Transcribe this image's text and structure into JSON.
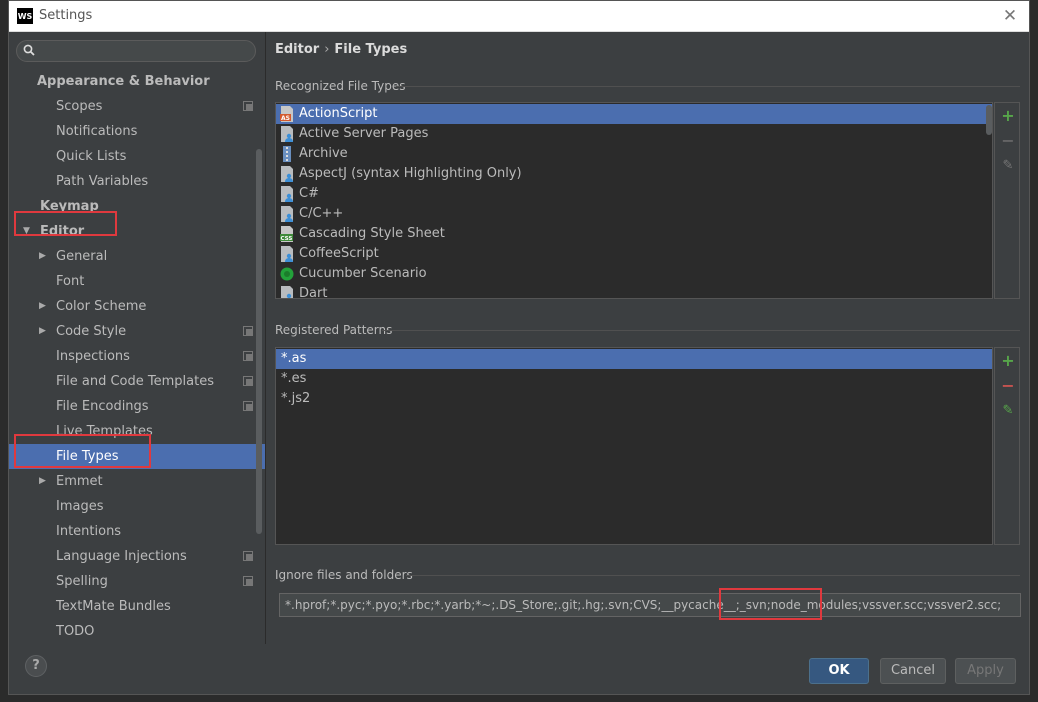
{
  "window": {
    "title": "Settings",
    "logo": "WS"
  },
  "search": {
    "placeholder": "",
    "value": ""
  },
  "nav": [
    {
      "label": "Appearance & Behavior",
      "type": "group"
    },
    {
      "label": "Scopes",
      "indent": 2,
      "proj": true
    },
    {
      "label": "Notifications",
      "indent": 2
    },
    {
      "label": "Quick Lists",
      "indent": 2
    },
    {
      "label": "Path Variables",
      "indent": 2
    },
    {
      "label": "Keymap",
      "type": "group"
    },
    {
      "label": "Editor",
      "type": "group-open"
    },
    {
      "label": "General",
      "indent": 2,
      "expandable": true
    },
    {
      "label": "Font",
      "indent": 2
    },
    {
      "label": "Color Scheme",
      "indent": 2,
      "expandable": true
    },
    {
      "label": "Code Style",
      "indent": 2,
      "expandable": true,
      "proj": true
    },
    {
      "label": "Inspections",
      "indent": 2,
      "proj": true
    },
    {
      "label": "File and Code Templates",
      "indent": 2,
      "proj": true
    },
    {
      "label": "File Encodings",
      "indent": 2,
      "proj": true
    },
    {
      "label": "Live Templates",
      "indent": 2
    },
    {
      "label": "File Types",
      "indent": 2,
      "selected": true
    },
    {
      "label": "Emmet",
      "indent": 2,
      "expandable": true
    },
    {
      "label": "Images",
      "indent": 2
    },
    {
      "label": "Intentions",
      "indent": 2
    },
    {
      "label": "Language Injections",
      "indent": 2,
      "proj": true
    },
    {
      "label": "Spelling",
      "indent": 2,
      "proj": true
    },
    {
      "label": "TextMate Bundles",
      "indent": 2
    },
    {
      "label": "TODO",
      "indent": 2
    }
  ],
  "breadcrumb": {
    "parent": "Editor",
    "sep": "›",
    "current": "File Types"
  },
  "recognized": {
    "title": "Recognized File Types",
    "items": [
      {
        "label": "ActionScript",
        "icon": "actionscript-icon",
        "selected": true
      },
      {
        "label": "Active Server Pages",
        "icon": "file-person-icon"
      },
      {
        "label": "Archive",
        "icon": "archive-icon"
      },
      {
        "label": "AspectJ (syntax Highlighting Only)",
        "icon": "file-person-icon"
      },
      {
        "label": "C#",
        "icon": "file-person-icon"
      },
      {
        "label": "C/C++",
        "icon": "file-person-icon"
      },
      {
        "label": "Cascading Style Sheet",
        "icon": "css-icon"
      },
      {
        "label": "CoffeeScript",
        "icon": "file-person-icon"
      },
      {
        "label": "Cucumber Scenario",
        "icon": "cucumber-icon"
      },
      {
        "label": "Dart",
        "icon": "file-person-icon"
      }
    ]
  },
  "patterns": {
    "title": "Registered Patterns",
    "items": [
      {
        "label": "*.as",
        "selected": true
      },
      {
        "label": "*.es"
      },
      {
        "label": "*.js2"
      }
    ]
  },
  "ignore": {
    "title": "Ignore files and folders",
    "value": "*.hprof;*.pyc;*.pyo;*.rbc;*.yarb;*~;.DS_Store;.git;.hg;.svn;CVS;__pycache__;_svn;node_modules;vssver.scc;vssver2.scc;"
  },
  "tools": {
    "add": "+",
    "remove": "−",
    "edit": "✎"
  },
  "buttons": {
    "help": "?",
    "ok": "OK",
    "cancel": "Cancel",
    "apply": "Apply"
  },
  "colors": {
    "accent": "#4b6eaf",
    "add": "#57a64a",
    "remove": "#c75450",
    "highlight": "#e0393e"
  }
}
